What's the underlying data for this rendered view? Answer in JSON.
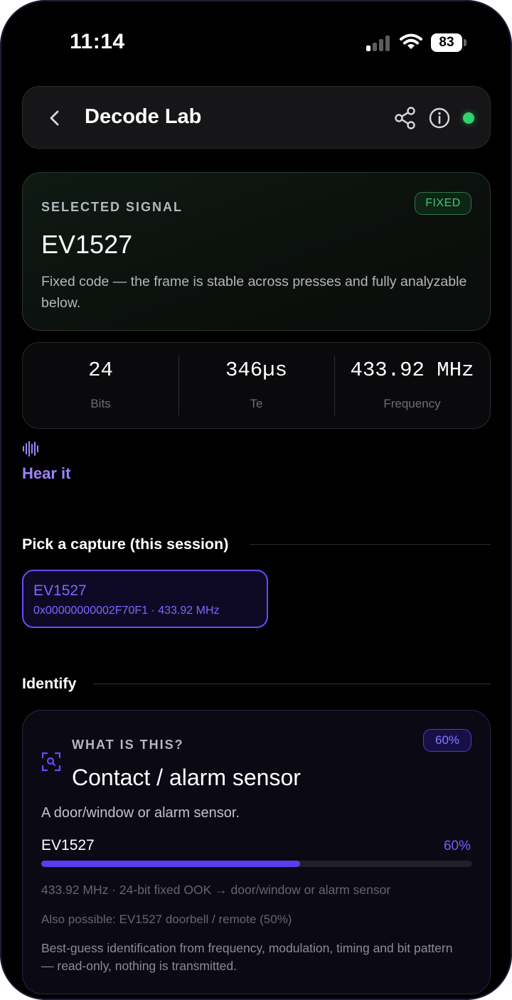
{
  "status_bar": {
    "time": "11:14",
    "battery": "83"
  },
  "header": {
    "title": "Decode Lab",
    "status_color": "#2fd36c"
  },
  "selected_signal": {
    "eyebrow": "SELECTED SIGNAL",
    "badge": "FIXED",
    "name": "EV1527",
    "description": "Fixed code — the frame is stable across presses and fully analyzable below."
  },
  "stats": [
    {
      "value": "24",
      "label": "Bits"
    },
    {
      "value": "346µs",
      "label": "Te"
    },
    {
      "value": "433.92 MHz",
      "label": "Frequency"
    }
  ],
  "hear_it": {
    "label": "Hear it",
    "icon": "waveform-icon"
  },
  "capture_section": {
    "title": "Pick a capture (this session)",
    "captures": [
      {
        "name": "EV1527",
        "meta": "0x00000000002F70F1 · 433.92 MHz"
      }
    ]
  },
  "identify_section": {
    "title": "Identify",
    "eyebrow": "WHAT IS THIS?",
    "badge": "60%",
    "device": "Contact / alarm sensor",
    "description": "A door/window or alarm sensor.",
    "match": {
      "protocol": "EV1527",
      "percent_label": "60%",
      "confidence": 0.6
    },
    "detail": "433.92 MHz · 24-bit fixed OOK → door/window or alarm sensor",
    "also_possible": "Also possible: EV1527 doorbell / remote (50%)",
    "note": "Best-guess identification from frequency, modulation, timing and bit pattern — read-only, nothing is transmitted."
  },
  "colors": {
    "accent": "#7a5cff",
    "success": "#2fd36c",
    "background": "#000000"
  }
}
